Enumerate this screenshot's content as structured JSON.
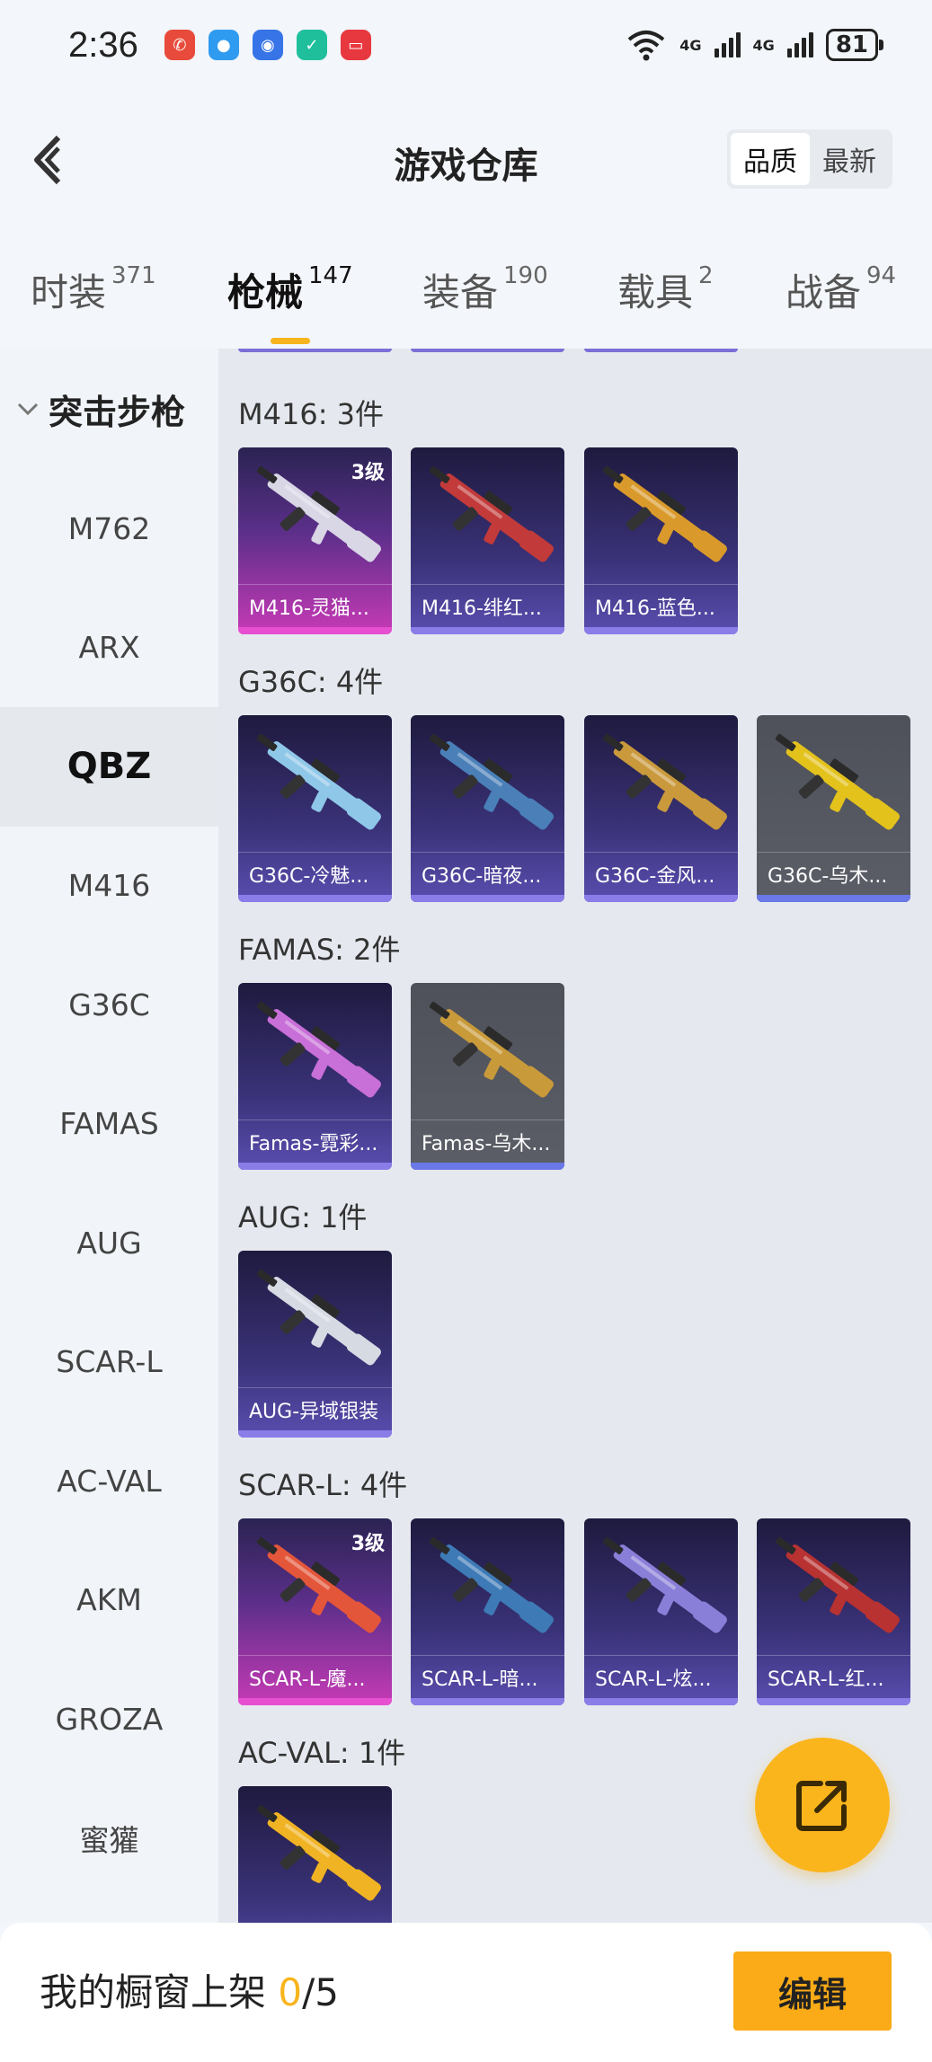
{
  "status_bar": {
    "time": "2:36",
    "signal_1": "4G",
    "signal_2": "4G",
    "battery": "81",
    "notification_icons": [
      "phone-missed-icon",
      "chat-icon",
      "app-shield-icon",
      "security-check-icon",
      "red-app-icon"
    ]
  },
  "header": {
    "title": "游戏仓库",
    "sort_options": [
      "品质",
      "最新"
    ],
    "sort_selected": "品质"
  },
  "tabs": [
    {
      "label": "时装",
      "count": "371"
    },
    {
      "label": "枪械",
      "count": "147"
    },
    {
      "label": "装备",
      "count": "190"
    },
    {
      "label": "载具",
      "count": "2"
    },
    {
      "label": "战备",
      "count": "94"
    }
  ],
  "active_tab": "枪械",
  "sidebar": {
    "category": "突击步枪",
    "items": [
      "M762",
      "ARX",
      "QBZ",
      "M416",
      "G36C",
      "FAMAS",
      "AUG",
      "SCAR-L",
      "AC-VAL",
      "AKM",
      "GROZA",
      "蜜獾"
    ],
    "active": "QBZ"
  },
  "groups": [
    {
      "label": "M416: 3件",
      "items": [
        {
          "name": "M416-灵猫...",
          "grade": "3级",
          "rarity": "pink"
        },
        {
          "name": "M416-绯红...",
          "rarity": "purple"
        },
        {
          "name": "M416-蓝色...",
          "rarity": "purple"
        }
      ]
    },
    {
      "label": "G36C: 4件",
      "items": [
        {
          "name": "G36C-冷魅...",
          "rarity": "purple"
        },
        {
          "name": "G36C-暗夜...",
          "rarity": "purple"
        },
        {
          "name": "G36C-金风...",
          "rarity": "purple"
        },
        {
          "name": "G36C-乌木...",
          "rarity": "gray"
        }
      ]
    },
    {
      "label": "FAMAS: 2件",
      "items": [
        {
          "name": "Famas-霓彩...",
          "rarity": "purple"
        },
        {
          "name": "Famas-乌木...",
          "rarity": "gray"
        }
      ]
    },
    {
      "label": "AUG: 1件",
      "items": [
        {
          "name": "AUG-异域银装",
          "rarity": "purple"
        }
      ]
    },
    {
      "label": "SCAR-L: 4件",
      "items": [
        {
          "name": "SCAR-L-魔...",
          "grade": "3级",
          "rarity": "pink"
        },
        {
          "name": "SCAR-L-暗...",
          "rarity": "purple"
        },
        {
          "name": "SCAR-L-炫...",
          "rarity": "purple"
        },
        {
          "name": "SCAR-L-红...",
          "rarity": "purple"
        }
      ]
    },
    {
      "label": "AC-VAL: 1件",
      "items": [
        {
          "name": "",
          "rarity": "purple"
        }
      ]
    }
  ],
  "bottom_bar": {
    "label": "我的橱窗上架 ",
    "current": "0",
    "total": "/5",
    "edit_button": "编辑"
  },
  "colors": {
    "accent": "#f8b41c",
    "rarity_pink": "#d13fb9",
    "rarity_purple": "#5b4fb8",
    "rarity_gray": "#5a5d66"
  },
  "gun_colors": [
    "#d9d6e6",
    "#c23a3a",
    "#d99a2b",
    "#8fc7e8",
    "#4a7fb8",
    "#c9993c",
    "#e3c21c",
    "#c86fd8",
    "#c89a3a",
    "#d6dae3",
    "#e4563a",
    "#3e7ab6",
    "#8a7fd8",
    "#b83232",
    "#f0b323"
  ]
}
